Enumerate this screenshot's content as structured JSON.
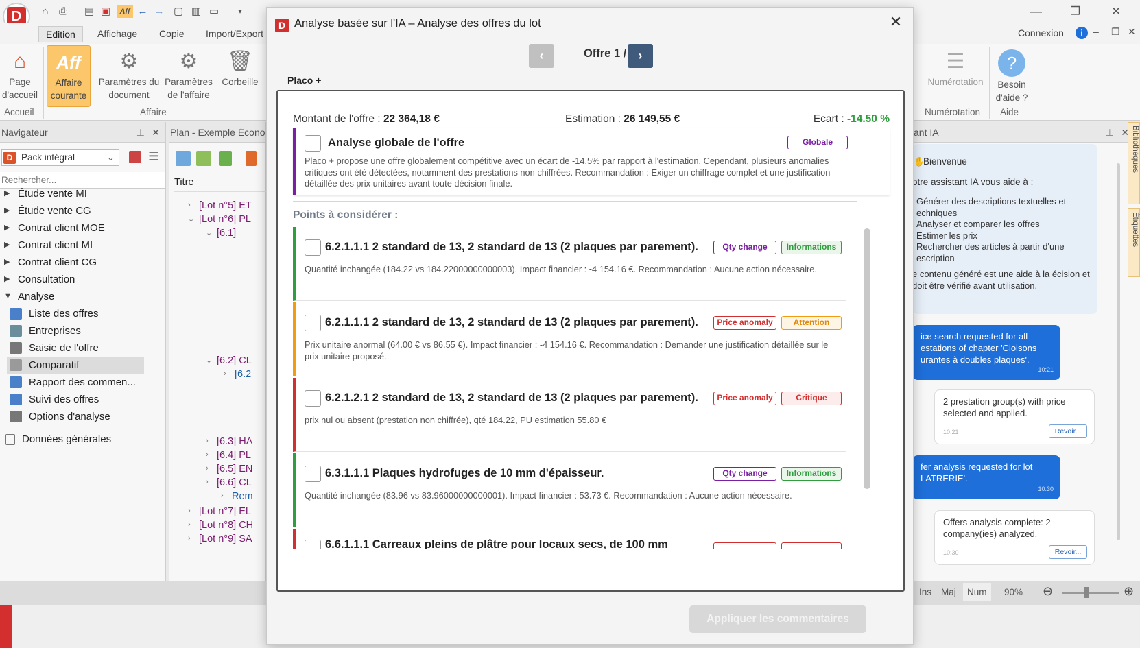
{
  "app": {
    "tabs": [
      "Edition",
      "Affichage",
      "Copie",
      "Import/Export"
    ],
    "connexion": "Connexion"
  },
  "ribbon": {
    "page_accueil": "Page d'accueil",
    "affaire_courante": "Affaire courante",
    "parametres_document": "Paramètres du document",
    "parametres_affaire": "Paramètres de l'affaire",
    "corbeille": "Corbeille",
    "groups": {
      "accueil": "Accueil",
      "affaire": "Affaire"
    },
    "numerotation": "Numérotation",
    "besoin_aide": "Besoin d'aide ?",
    "groups_right": {
      "numerotation": "Numérotation",
      "aide": "Aide"
    },
    "aff_logo": "Aff"
  },
  "navigator": {
    "title": "Navigateur",
    "selector": "Pack intégral",
    "search_placeholder": "Rechercher...",
    "items": [
      "Étude vente MI",
      "Étude vente CG",
      "Contrat client MOE",
      "Contrat client MI",
      "Contrat client CG",
      "Consultation",
      "Analyse"
    ],
    "sub_items": [
      "Liste des offres",
      "Entreprises",
      "Saisie de l'offre",
      "Comparatif",
      "Rapport des commen...",
      "Suivi des offres",
      "Options d'analyse"
    ],
    "selected_sub": "Comparatif",
    "footer": "Données générales"
  },
  "plan": {
    "title": "Plan - Exemple Écono",
    "col_title": "Titre",
    "rows": [
      "[Lot n°5] ET",
      "[Lot n°6] PL",
      "[6.1]",
      "[6.2] CL",
      "[6.2",
      "[6.3] HA",
      "[6.4] PL",
      "[6.5] EN",
      "[6.6] CL",
      "Rem",
      "[Lot n°7] EL",
      "[Lot n°8] CH",
      "[Lot n°9] SA"
    ]
  },
  "assistant": {
    "title": "ant IA",
    "welcome": "Bienvenue",
    "intro": "otre assistant IA vous aide à :",
    "bullets": [
      "Générer des descriptions textuelles et echniques",
      "Analyser et comparer les offres",
      "Estimer les prix",
      "Rechercher des articles à partir d'une escription"
    ],
    "disclaimer": "e contenu généré est une aide à la écision et doit être vérifié avant utilisation.",
    "messages": [
      {
        "text": "ice search requested for all estations of chapter 'Cloisons urantes à doubles plaques'.",
        "time": "10:21"
      },
      {
        "text": "2 prestation group(s) with price selected and applied.",
        "time": "10:21",
        "action": "Revoir..."
      },
      {
        "text": "fer analysis requested for lot LATRERIE'.",
        "time": "10:30"
      },
      {
        "text": "Offers analysis complete: 2 company(ies) analyzed.",
        "time": "10:30",
        "action": "Revoir..."
      }
    ],
    "side_tabs": [
      "Bibliothèques",
      "Étiquettes"
    ]
  },
  "statusbar": {
    "ins": "Ins",
    "maj": "Maj",
    "num": "Num",
    "zoom": "90%"
  },
  "modal": {
    "title": "Analyse basée sur l'IA – Analyse des offres du lot",
    "offer_label": "Offre 1 / 2",
    "supplier": "Placo +",
    "montant_label": "Montant de l'offre :",
    "montant_value": "22 364,18 €",
    "estimation_label": "Estimation :",
    "estimation_value": "26 149,55 €",
    "ecart_label": "Ecart :",
    "ecart_value": "-14.50 %",
    "global": {
      "title": "Analyse globale de l'offre",
      "badge": "Globale",
      "text": "Placo + propose une offre globalement compétitive avec un écart de -14.5% par rapport à l'estimation. Cependant, plusieurs anomalies critiques ont été détectées, notamment des prestations non chiffrées. Recommandation : Exiger un chiffrage complet et une justification détaillée des prix unitaires avant toute décision finale."
    },
    "points_title": "Points à considérer :",
    "points": [
      {
        "title": "6.2.1.1.1 2 standard de 13, 2 standard de 13 (2 plaques par parement).",
        "type": "Qty change",
        "level": "Informations",
        "text": "Quantité inchangée (184.22 vs 184.22000000000003). Impact financier : -4 154.16 €. Recommandation : Aucune action nécessaire."
      },
      {
        "title": "6.2.1.1.1 2 standard de 13, 2 standard de 13 (2 plaques par parement).",
        "type": "Price anomaly",
        "level": "Attention",
        "text": "Prix unitaire anormal (64.00 € vs 86.55 €). Impact financier : -4 154.16 €. Recommandation : Demander une justification détaillée sur le prix unitaire proposé."
      },
      {
        "title": "6.2.1.2.1 2 standard de 13, 2 standard de 13 (2 plaques par parement).",
        "type": "Price anomaly",
        "level": "Critique",
        "text": "prix nul ou absent (prestation non chiffrée), qté 184.22, PU estimation 55.80 €"
      },
      {
        "title": "6.3.1.1.1 Plaques hydrofuges de 10 mm d'épaisseur.",
        "type": "Qty change",
        "level": "Informations",
        "text": "Quantité inchangée (83.96 vs 83.96000000000001). Impact financier : 53.73 €. Recommandation : Aucune action nécessaire."
      },
      {
        "title": "6.6.1.1.1 Carreaux pleins de plâtre pour locaux secs, de 100 mm",
        "type": "",
        "level": "",
        "text": ""
      }
    ],
    "apply_button": "Appliquer les commentaires"
  },
  "colors": {
    "accent_blue": "#1e6fd9",
    "nav_button": "#3f5a7a",
    "nav_button_disabled": "#b8b8b8",
    "positive_green": "#2e9e3e",
    "global_purple": "#7b1fa2",
    "info_green": "#2e9e3e",
    "attention_orange": "#f39c12",
    "critical_red": "#d0302f",
    "qty_purple": "#7b1fa2"
  }
}
